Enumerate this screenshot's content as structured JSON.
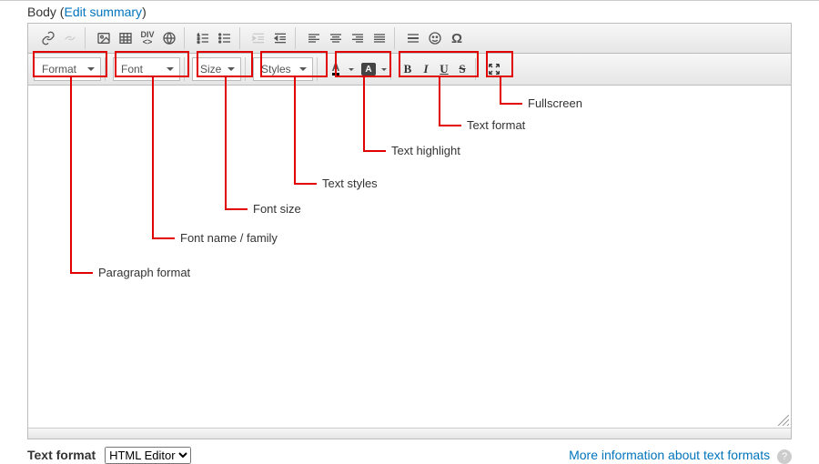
{
  "header": {
    "body_label": "Body",
    "edit_summary": "Edit summary"
  },
  "toolbar2": {
    "format": "Format",
    "font": "Font",
    "size": "Size",
    "styles": "Styles",
    "bold": "B",
    "italic": "I",
    "underline": "U",
    "strike": "S",
    "letterA": "A",
    "boxA": "A"
  },
  "callouts": {
    "paragraph": "Paragraph format",
    "fontname": "Font name / family",
    "fontsize": "Font size",
    "textstyles": "Text styles",
    "highlight": "Text highlight",
    "textformat": "Text format",
    "fullscreen": "Fullscreen"
  },
  "bottom": {
    "label": "Text format",
    "select_value": "HTML Editor",
    "more_info": "More information about text formats",
    "help": "?"
  }
}
